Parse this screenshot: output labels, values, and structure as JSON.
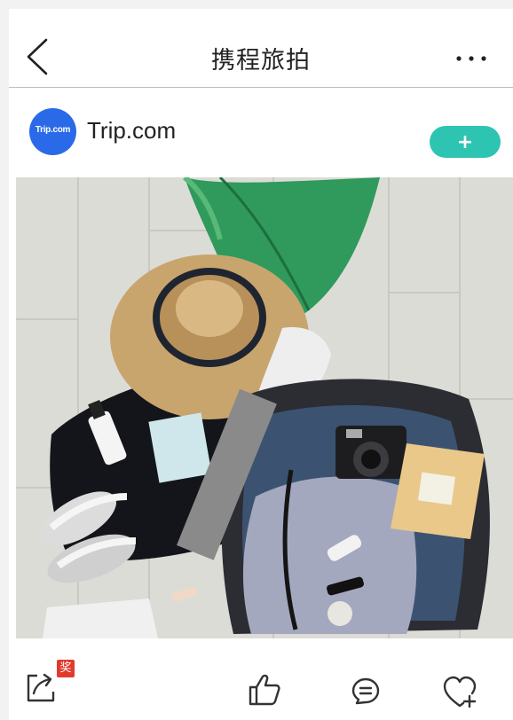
{
  "header": {
    "title": "携程旅拍",
    "back_icon": "chevron-left-icon",
    "more_icon": "more-dots-icon"
  },
  "author": {
    "avatar_text": "Trip.com",
    "name": "Trip.com",
    "follow_label": "+"
  },
  "photo": {
    "icon": "travel-photo"
  },
  "actions": {
    "reward_badge": "奖",
    "icons": [
      "share-icon",
      "like-icon",
      "comment-icon",
      "collect-icon"
    ]
  },
  "colors": {
    "accent": "#2ec4b2",
    "avatar_bg": "#2a6ae8",
    "badge": "#e23a2e"
  }
}
